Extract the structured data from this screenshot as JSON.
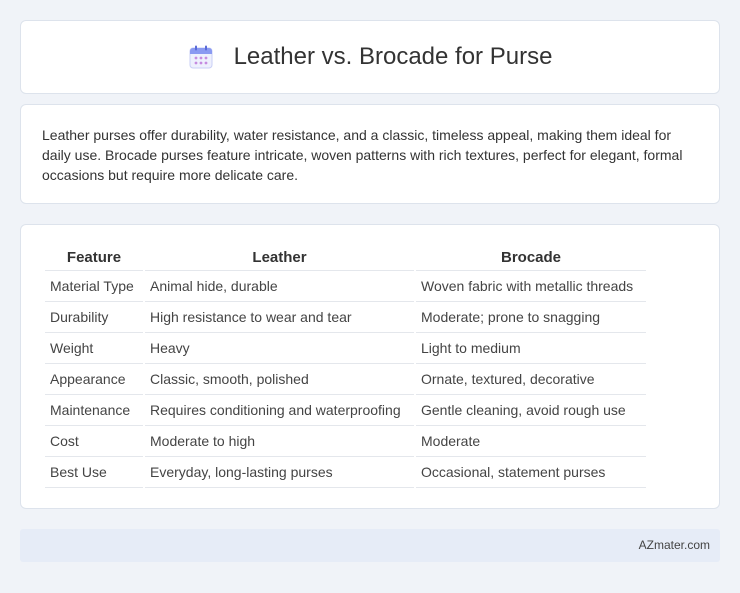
{
  "header": {
    "title": "Leather vs. Brocade for Purse",
    "icon": "calendar-icon"
  },
  "intro": {
    "text": "Leather purses offer durability, water resistance, and a classic, timeless appeal, making them ideal for daily use. Brocade purses feature intricate, woven patterns with rich textures, perfect for elegant, formal occasions but require more delicate care."
  },
  "table": {
    "headers": [
      "Feature",
      "Leather",
      "Brocade"
    ],
    "rows": [
      [
        "Material Type",
        "Animal hide, durable",
        "Woven fabric with metallic threads"
      ],
      [
        "Durability",
        "High resistance to wear and tear",
        "Moderate; prone to snagging"
      ],
      [
        "Weight",
        "Heavy",
        "Light to medium"
      ],
      [
        "Appearance",
        "Classic, smooth, polished",
        "Ornate, textured, decorative"
      ],
      [
        "Maintenance",
        "Requires conditioning and waterproofing",
        "Gentle cleaning, avoid rough use"
      ],
      [
        "Cost",
        "Moderate to high",
        "Moderate"
      ],
      [
        "Best Use",
        "Everyday, long-lasting purses",
        "Occasional, statement purses"
      ]
    ]
  },
  "footer": {
    "brand": "AZmater.com"
  },
  "colors": {
    "background": "#f0f3f8",
    "card": "#ffffff",
    "footer_bg": "#e6ecf7",
    "icon_accent": "#7b8cf0"
  }
}
